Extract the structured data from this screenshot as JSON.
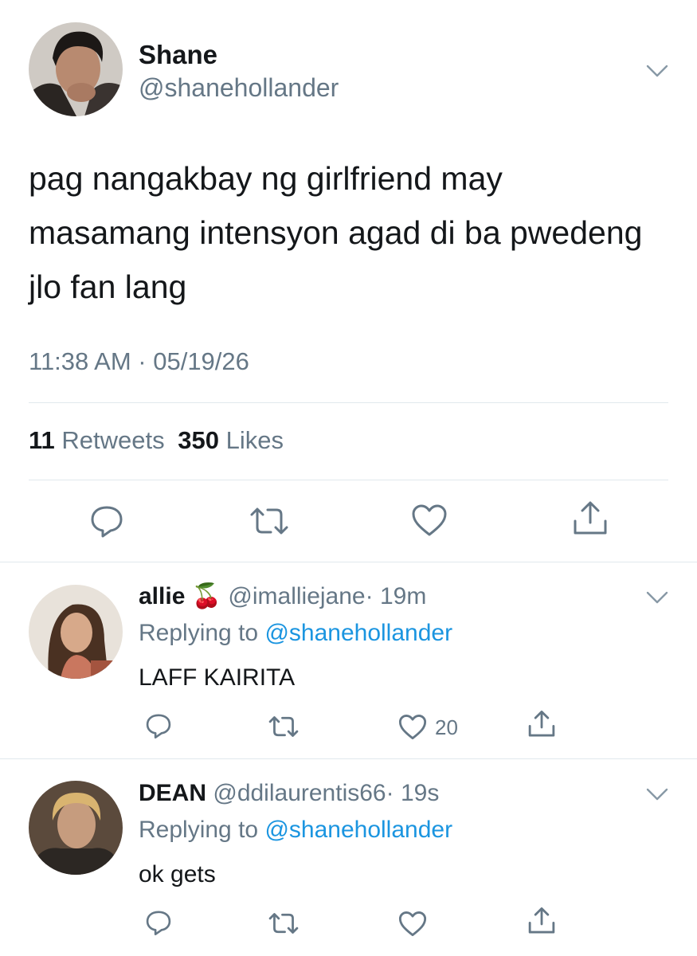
{
  "main_tweet": {
    "name": "Shane",
    "handle": "@shanehollander",
    "text": "pag nangakbay ng girlfriend may masamang intensyon agad di ba pwedeng jlo fan lang",
    "timestamp": "11:38 AM · 05/19/26",
    "retweets_count": "11",
    "retweets_label": "Retweets",
    "likes_count": "350",
    "likes_label": "Likes",
    "actions": [
      "reply-icon",
      "retweet-icon",
      "like-icon",
      "share-icon"
    ]
  },
  "replies": [
    {
      "name": "allie",
      "emoji": "🍒",
      "handle": "@imalliejane",
      "time": "· 19m",
      "replying_prefix": "Replying to",
      "replying_to": "@shanehollander",
      "text": "LAFF KAIRITA",
      "like_count": "20"
    },
    {
      "name": "DEAN",
      "handle": "@ddilaurentis66",
      "time": "· 19s",
      "replying_prefix": "Replying to",
      "replying_to": "@shanehollander",
      "text": "ok gets",
      "like_count": ""
    }
  ],
  "colors": {
    "text": "#14171a",
    "muted": "#657786",
    "link": "#1b95e0",
    "divider": "#e1e8ed"
  }
}
